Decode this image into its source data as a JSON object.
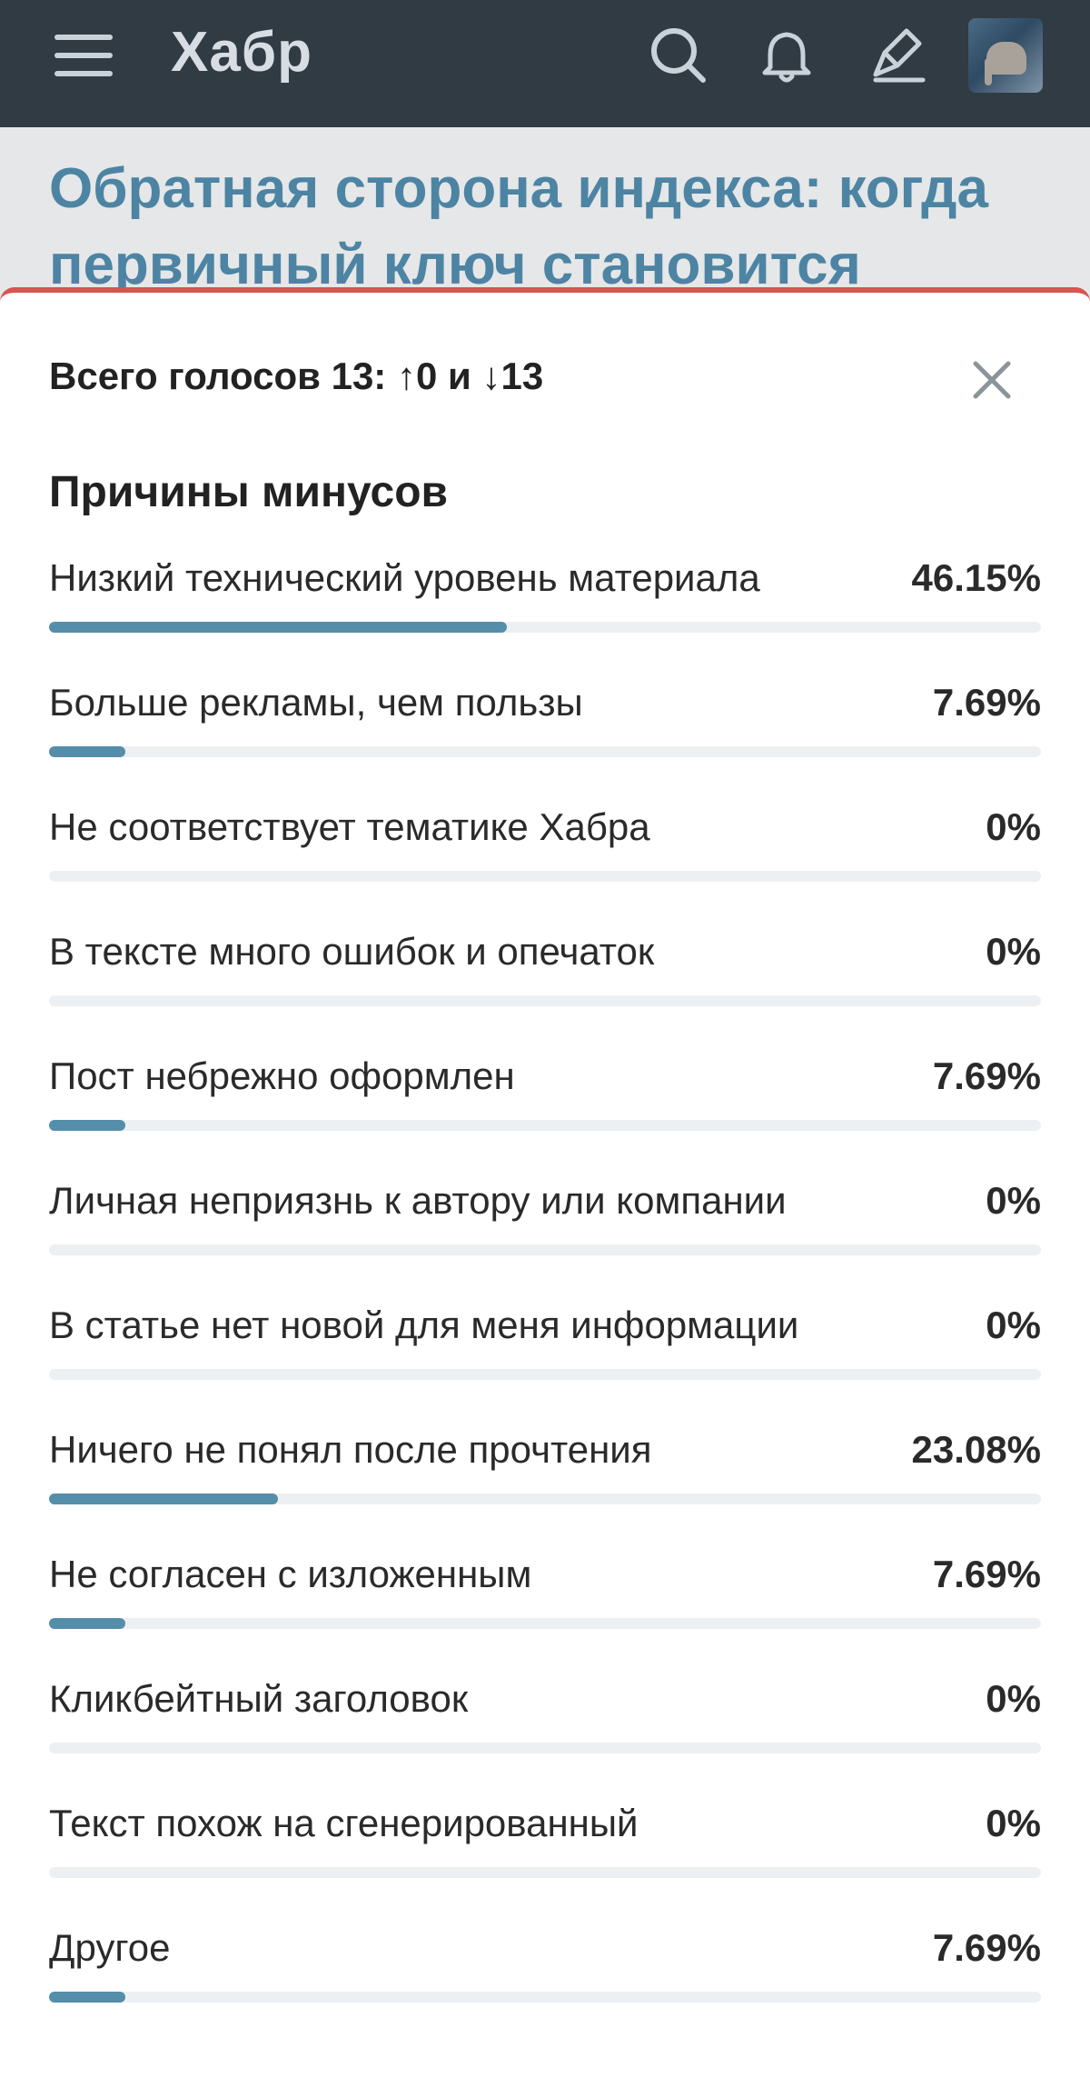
{
  "header": {
    "logo": "Хабр",
    "icons": [
      "menu-icon",
      "search-icon",
      "bell-icon",
      "pen-icon",
      "avatar"
    ]
  },
  "article": {
    "title": "Обратная сторона индекса: когда первичный ключ становится"
  },
  "votes": {
    "summary": "Всего голосов 13: ↑0 и ↓13",
    "total": 13,
    "up": 0,
    "down": 13
  },
  "reasons": {
    "title": "Причины минусов",
    "items": [
      {
        "label": "Низкий технический уровень материала",
        "percent": "46.15%",
        "value": 46.15
      },
      {
        "label": "Больше рекламы, чем пользы",
        "percent": "7.69%",
        "value": 7.69
      },
      {
        "label": "Не соответствует тематике Хабра",
        "percent": "0%",
        "value": 0
      },
      {
        "label": "В тексте много ошибок и опечаток",
        "percent": "0%",
        "value": 0
      },
      {
        "label": "Пост небрежно оформлен",
        "percent": "7.69%",
        "value": 7.69
      },
      {
        "label": "Личная неприязнь к автору или компании",
        "percent": "0%",
        "value": 0
      },
      {
        "label": "В статье нет новой для меня информации",
        "percent": "0%",
        "value": 0
      },
      {
        "label": "Ничего не понял после прочтения",
        "percent": "23.08%",
        "value": 23.08
      },
      {
        "label": "Не согласен с изложенным",
        "percent": "7.69%",
        "value": 7.69
      },
      {
        "label": "Кликбейтный заголовок",
        "percent": "0%",
        "value": 0
      },
      {
        "label": "Текст похож на сгенерированный",
        "percent": "0%",
        "value": 0
      },
      {
        "label": "Другое",
        "percent": "7.69%",
        "value": 7.69
      }
    ]
  },
  "colors": {
    "header_bg": "#303b44",
    "accent_bar": "#548eaa",
    "title_link": "#4d84a3",
    "sheet_top_border": "#d9534f"
  }
}
